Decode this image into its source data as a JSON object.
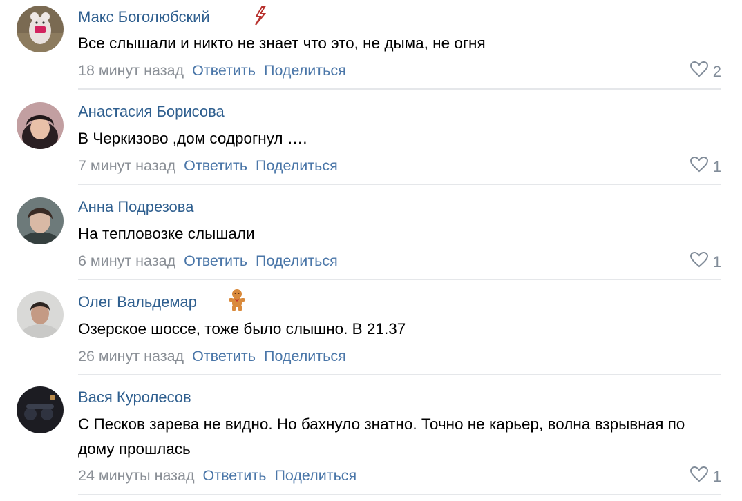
{
  "comments": [
    {
      "author": "Макс Боголюбский",
      "badge": "lightning-icon",
      "text": "Все слышали и никто не знает что это, не дыма, не огня",
      "time": "18 минут назад",
      "reply": "Ответить",
      "share": "Поделиться",
      "likes": "2"
    },
    {
      "author": "Анастасия Борисова",
      "text": "В Черкизово ,дом содрогнул ….",
      "time": "7 минут назад",
      "reply": "Ответить",
      "share": "Поделиться",
      "likes": "1"
    },
    {
      "author": "Анна Подрезова",
      "text": "На тепловозке слышали",
      "time": "6 минут назад",
      "reply": "Ответить",
      "share": "Поделиться",
      "likes": "1"
    },
    {
      "author": "Олег Вальдемар",
      "badge": "gingerbread-icon",
      "text": "Озерское шоссе, тоже было слышно. В 21.37",
      "time": "26 минут назад",
      "reply": "Ответить",
      "share": "Поделиться",
      "likes": ""
    },
    {
      "author": "Вася Куролесов",
      "text": "С Песков зарева не видно. Но бахнуло знатно. Точно не карьер, волна взрывная по дому прошлась",
      "time": "24 минуты назад",
      "reply": "Ответить",
      "share": "Поделиться",
      "likes": "1"
    }
  ],
  "colors": {
    "author": "#2f5f8f",
    "action": "#4a76a8",
    "meta": "#8a8f96",
    "divider": "#e5e7ea"
  }
}
